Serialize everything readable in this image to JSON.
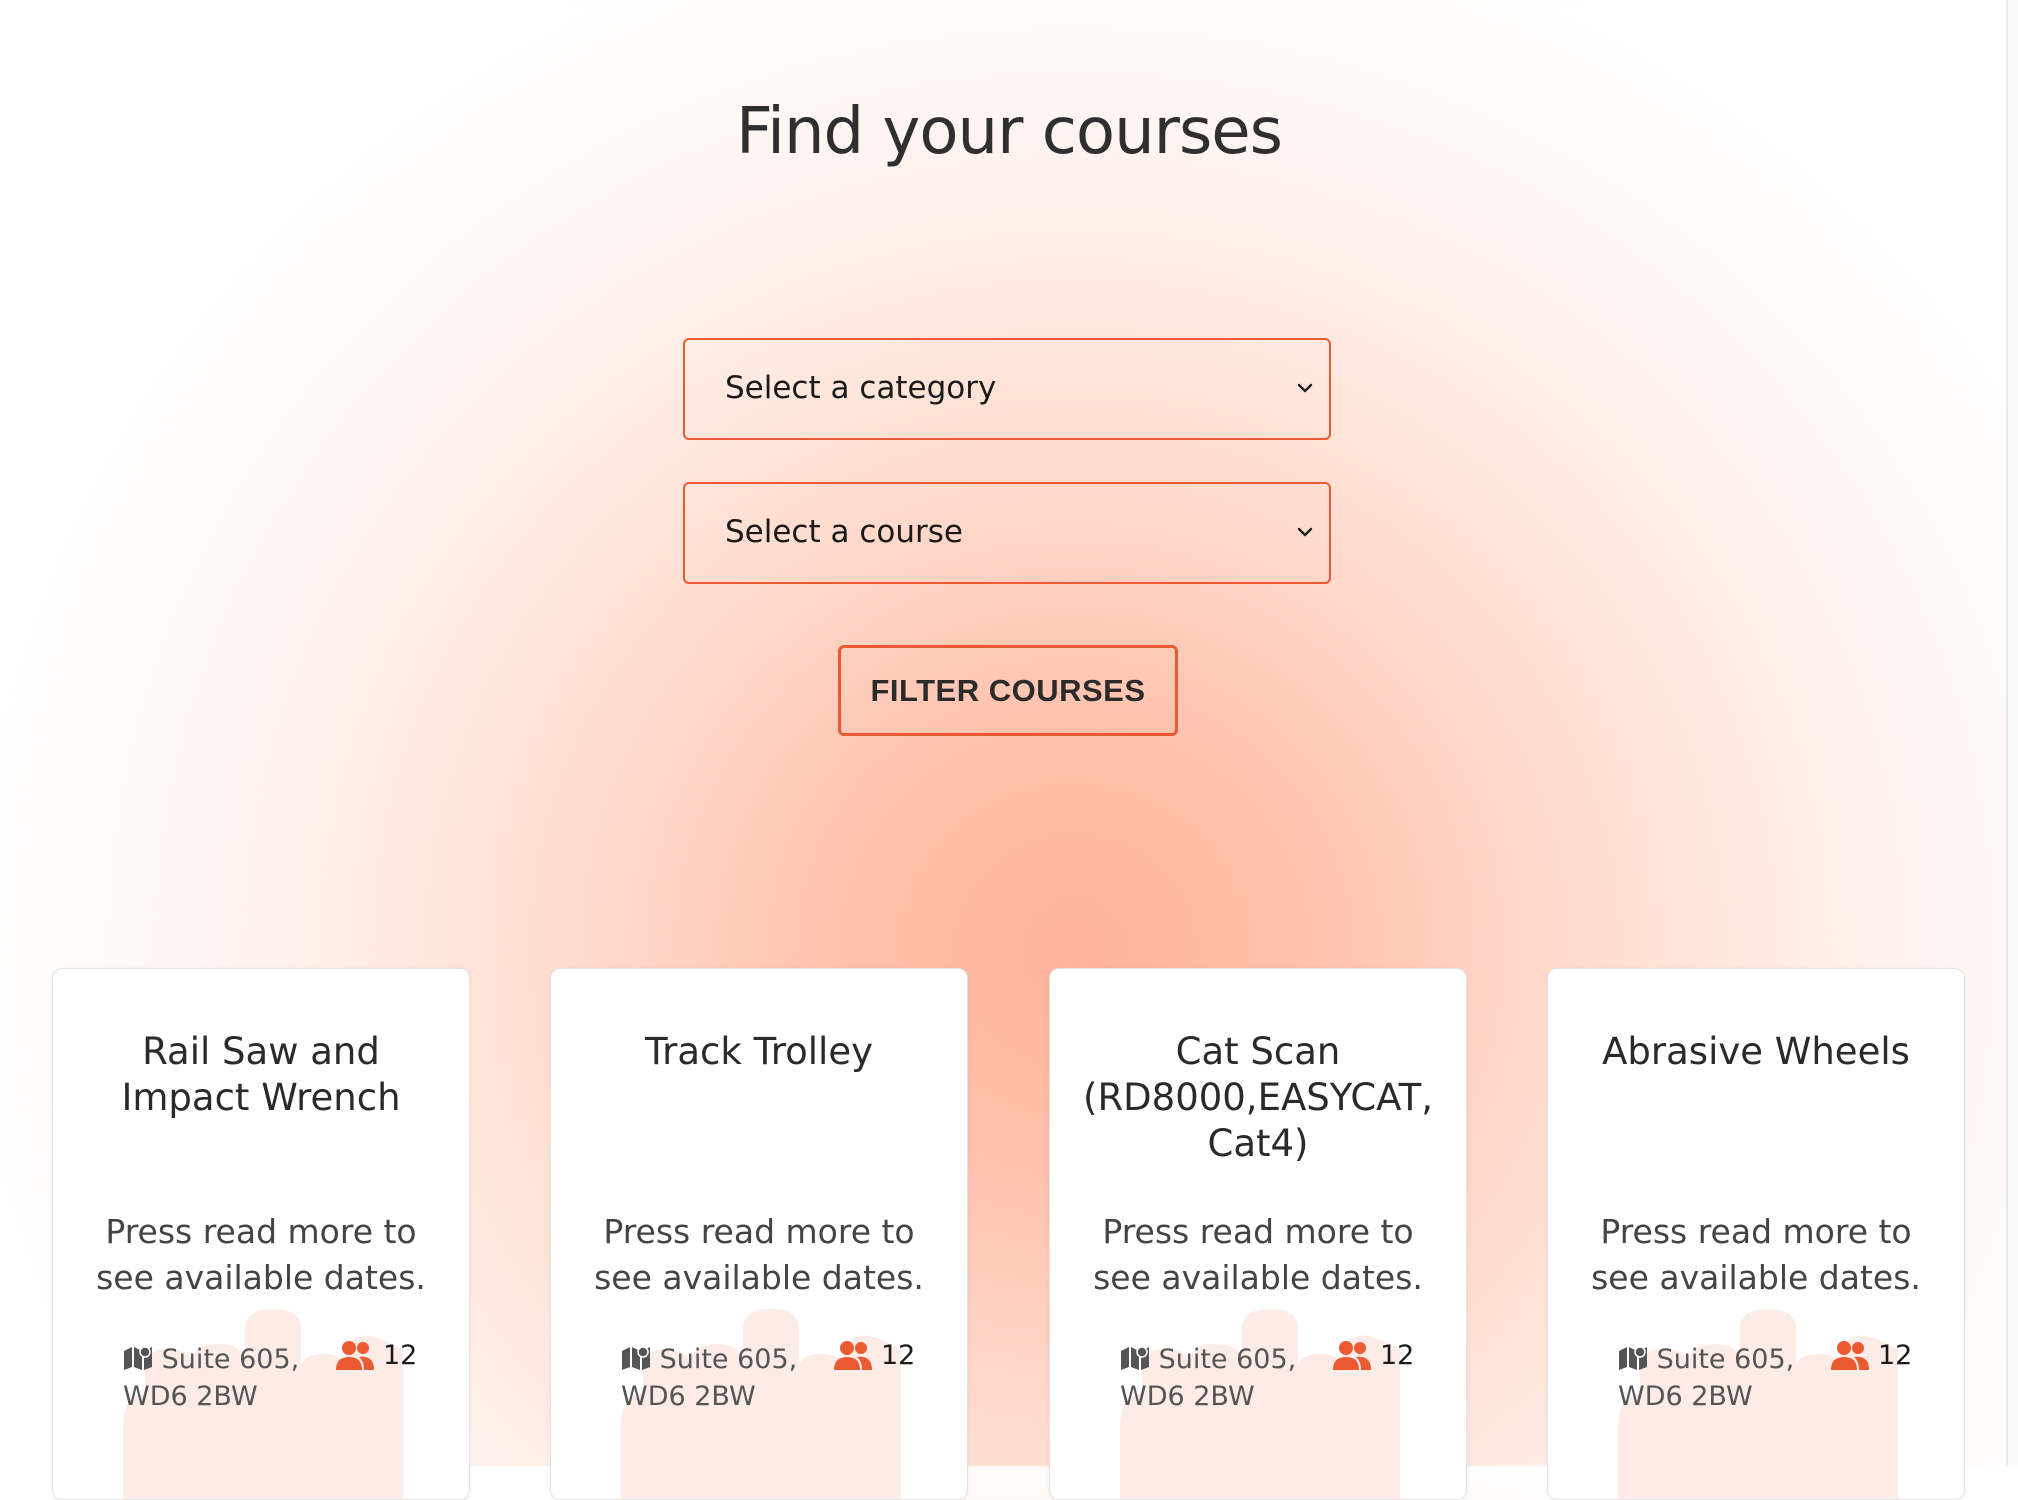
{
  "page": {
    "title": "Find your courses"
  },
  "filters": {
    "category": {
      "selected": "Select a category"
    },
    "course": {
      "selected": "Select a course"
    },
    "submit_label": "FILTER COURSES"
  },
  "colors": {
    "accent": "#ec5a33",
    "icon_gray": "#555555"
  },
  "courses": [
    {
      "title": "Rail Saw and Impact Wrench",
      "description": "Press read more to see available dates.",
      "location": "Suite 605, WD6 2BW",
      "capacity": "12"
    },
    {
      "title": "Track Trolley",
      "description": "Press read more to see available dates.",
      "location": "Suite 605, WD6 2BW",
      "capacity": "12"
    },
    {
      "title": "Cat Scan (RD8000,EASYCAT, Cat4)",
      "description": "Press read more to see available dates.",
      "location": "Suite 605, WD6 2BW",
      "capacity": "12"
    },
    {
      "title": "Abrasive Wheels",
      "description": "Press read more to see available dates.",
      "location": "Suite 605, WD6 2BW",
      "capacity": "12"
    }
  ],
  "icons": {
    "select_chevron": "chevron-down-icon",
    "location": "map-icon",
    "capacity": "users-icon",
    "card_background": "hand-watermark-icon"
  }
}
